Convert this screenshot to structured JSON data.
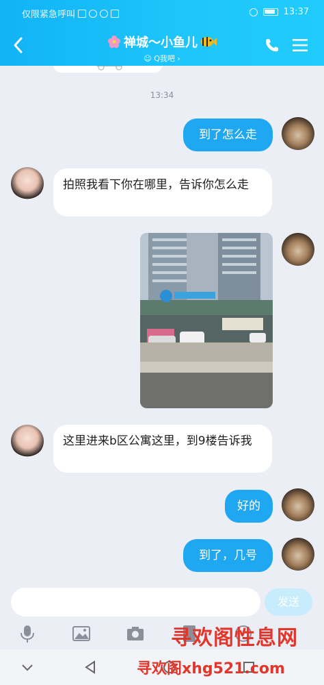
{
  "status_bar": {
    "carrier": "仅限紧急呼叫",
    "time": "13:37"
  },
  "header": {
    "title": "禅城～小鱼儿",
    "subtitle": "Q我吧",
    "subtitle_arrow": "›"
  },
  "chat": {
    "timestamp": "13:34",
    "messages": [
      {
        "sender": "me",
        "text": "到了怎么走"
      },
      {
        "sender": "her",
        "text": "拍照我看下你在哪里，告诉你怎么走"
      },
      {
        "sender": "me",
        "type": "image"
      },
      {
        "sender": "her",
        "text": "这里进来b区公寓这里，到9楼告诉我"
      },
      {
        "sender": "me",
        "text": "好的"
      },
      {
        "sender": "me",
        "text": "到了，几号"
      }
    ]
  },
  "input": {
    "placeholder": "",
    "send_label": "发送"
  },
  "watermark": {
    "line1": "寻欢阁性息网",
    "line2": "寻欢阁xhg521.com"
  },
  "colors": {
    "header": "#1fc6fb",
    "outgoing_bubble": "#1fa8f1",
    "incoming_bubble": "#ffffff",
    "background": "#eceef5"
  }
}
